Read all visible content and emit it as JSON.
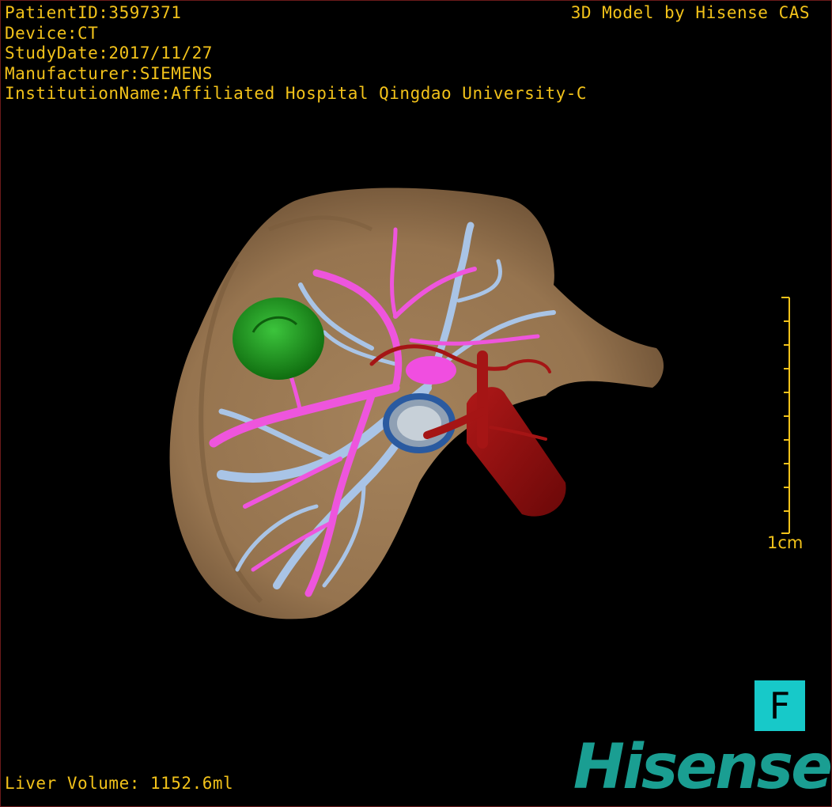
{
  "header": {
    "patient_id": "PatientID:3597371",
    "device": "Device:CT",
    "study_date": "StudyDate:2017/11/27",
    "manufacturer": "Manufacturer:SIEMENS",
    "institution": "InstitutionName:Affiliated Hospital Qingdao University-C"
  },
  "credit": "3D Model by Hisense CAS",
  "liver_volume": "Liver Volume: 1152.6ml",
  "scale": {
    "label": "1cm",
    "ticks": 11
  },
  "orientation_button": "F",
  "logo": "Hisense",
  "colors": {
    "text": "#f2c21a",
    "liver": "#9c7a55",
    "tumor": "#1f9a1f",
    "portal_vein": "#ee55dd",
    "hepatic_vein": "#a9c4e6",
    "artery": "#a51515",
    "bile": "#2a5aa0",
    "orientation_bg": "#17c9c9",
    "logo": "#1a9e92"
  }
}
